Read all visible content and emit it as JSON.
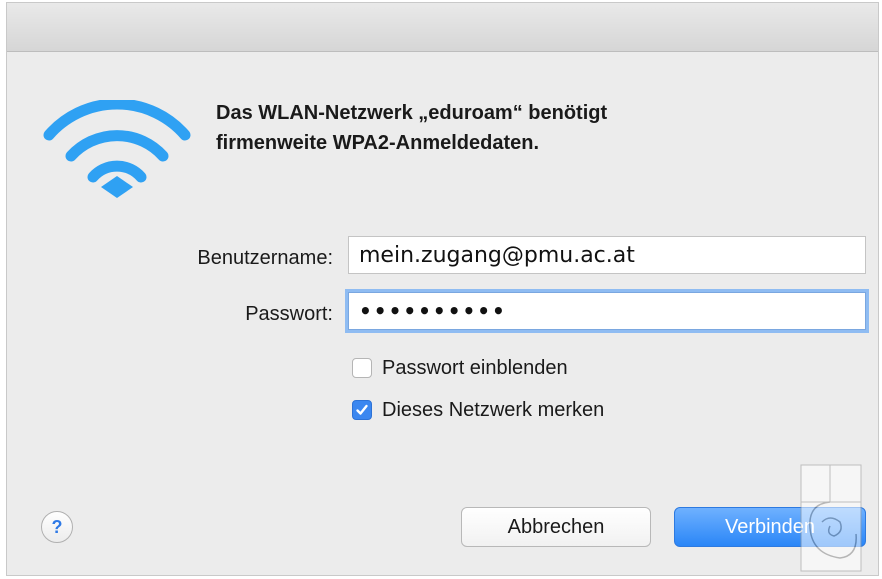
{
  "dialog": {
    "heading_line1": "Das WLAN-Netzwerk „eduroam“ benötigt",
    "heading_line2": "firmenweite WPA2-Anmeldedaten.",
    "wifi_icon": "wifi-icon",
    "accent_color": "#2a86f7"
  },
  "form": {
    "username_label": "Benutzername:",
    "username_value": "mein.zugang@pmu.ac.at",
    "password_label": "Passwort:",
    "password_value": "••••••••••"
  },
  "options": {
    "show_password_label": "Passwort einblenden",
    "show_password_checked": false,
    "remember_network_label": "Dieses Netzwerk merken",
    "remember_network_checked": true
  },
  "footer": {
    "help_label": "?",
    "cancel_label": "Abbrechen",
    "connect_label": "Verbinden"
  }
}
